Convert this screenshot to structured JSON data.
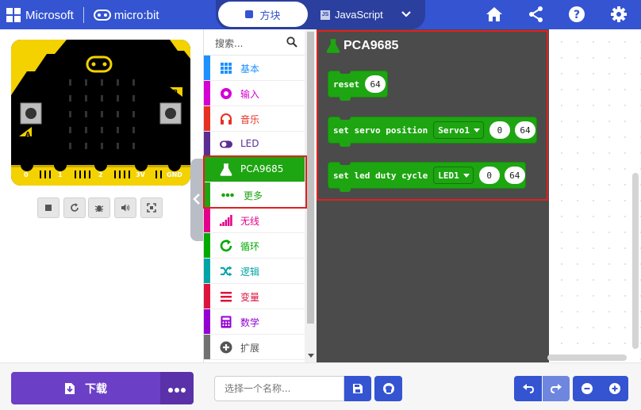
{
  "header": {
    "brand_microsoft": "Microsoft",
    "brand_microbit": "micro:bit",
    "tab_blocks": "方块",
    "tab_javascript": "JavaScript",
    "icons": [
      "home-icon",
      "share-icon",
      "help-icon",
      "settings-icon"
    ],
    "color": "#3454d1"
  },
  "simulator": {
    "pin_labels": [
      "0",
      "1",
      "2",
      "3V",
      "GND"
    ],
    "button_a": "A",
    "button_b": "B",
    "controls": [
      "stop-icon",
      "restart-icon",
      "debug-icon",
      "mute-icon",
      "fullscreen-icon"
    ]
  },
  "toolbox": {
    "search_placeholder": "搜索...",
    "categories": [
      {
        "label": "基本",
        "color": "#1e90ff",
        "icon": "grid-icon"
      },
      {
        "label": "输入",
        "color": "#d400d4",
        "icon": "target-icon"
      },
      {
        "label": "音乐",
        "color": "#e63022",
        "icon": "headphones-icon"
      },
      {
        "label": "LED",
        "color": "#5c2d91",
        "icon": "toggle-icon"
      },
      {
        "label": "PCA9685",
        "color": "#1ea512",
        "icon": "flask-icon"
      },
      {
        "label": "更多",
        "color": "#1ea512",
        "icon": "more-dots-icon"
      },
      {
        "label": "无线",
        "color": "#e3008c",
        "icon": "signal-icon"
      },
      {
        "label": "循环",
        "color": "#00aa00",
        "icon": "refresh-icon"
      },
      {
        "label": "逻辑",
        "color": "#00a4a6",
        "icon": "shuffle-icon"
      },
      {
        "label": "变量",
        "color": "#dc143c",
        "icon": "list-icon"
      },
      {
        "label": "数学",
        "color": "#9400d3",
        "icon": "calculator-icon"
      },
      {
        "label": "扩展",
        "color": "#717171",
        "icon": "plus-circle-icon"
      }
    ]
  },
  "flyout": {
    "title": "PCA9685",
    "blocks": [
      {
        "text": "reset",
        "value": "64"
      },
      {
        "text": "set servo position",
        "dropdown": "Servo1",
        "value1": "0",
        "value2": "64"
      },
      {
        "text": "set led duty cycle",
        "dropdown": "LED1",
        "value1": "0",
        "value2": "64"
      }
    ],
    "block_color": "#1ea512"
  },
  "footer": {
    "download_label": "下载",
    "name_placeholder": "选择一个名称..."
  }
}
